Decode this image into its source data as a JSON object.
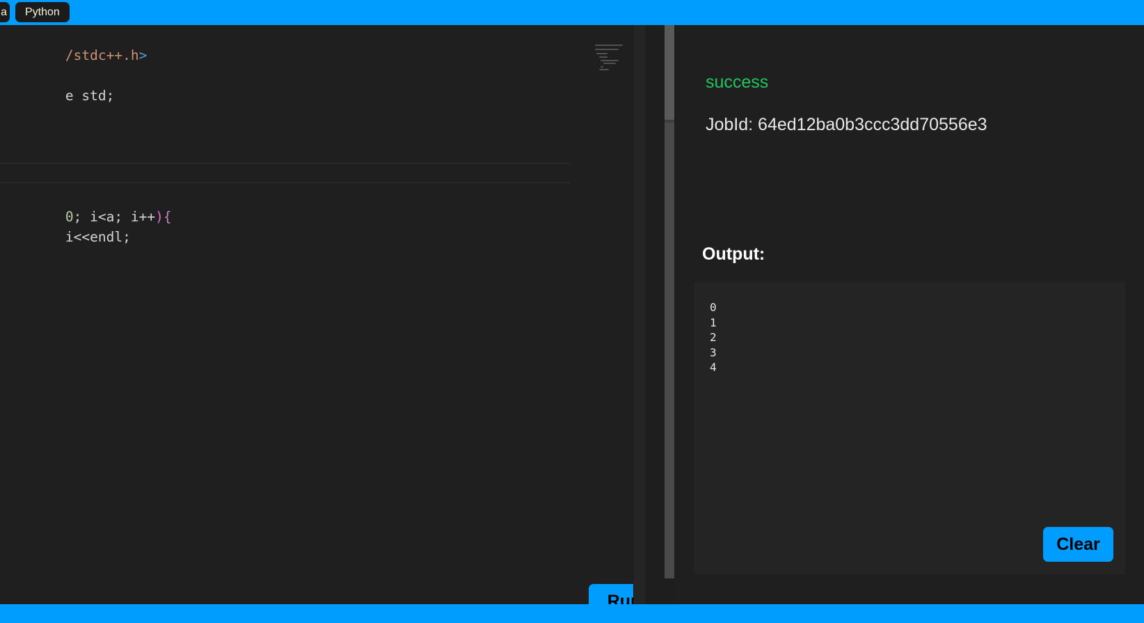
{
  "topbar": {
    "background_color": "#009dff",
    "language_tabs": [
      {
        "label": "a",
        "clipped": true
      },
      {
        "label": "Python",
        "clipped": false
      }
    ]
  },
  "editor": {
    "language": "cpp",
    "horizontally_scrolled": true,
    "visible_lines": [
      {
        "text": "/stdc++.h>",
        "tokens": [
          {
            "t": "/stdc++.h",
            "c": "inc"
          },
          {
            "t": ">",
            "c": "op"
          }
        ]
      },
      {
        "text": "",
        "tokens": []
      },
      {
        "text": "e std;",
        "tokens": [
          {
            "t": "e std;",
            "c": "plain"
          }
        ]
      },
      {
        "text": "",
        "tokens": []
      },
      {
        "text": "",
        "tokens": []
      },
      {
        "text": "",
        "tokens": []
      },
      {
        "text": "",
        "tokens": []
      },
      {
        "text": "",
        "tokens": []
      },
      {
        "text": "0; i<a; i++){",
        "tokens": [
          {
            "t": "0",
            "c": "num"
          },
          {
            "t": "; i<a; i++",
            "c": "plain"
          },
          {
            "t": ")",
            "c": "paren"
          },
          {
            "t": "{",
            "c": "key"
          }
        ]
      },
      {
        "text": "i<<endl;",
        "tokens": [
          {
            "t": "i<<endl;",
            "c": "plain"
          }
        ]
      }
    ],
    "run_button_label": "Run"
  },
  "result": {
    "status": "success",
    "status_color": "#22c55e",
    "job_id_label": "JobId: 64ed12ba0b3ccc3dd70556e3",
    "output_heading": "Output:",
    "output_text": "0\n1\n2\n3\n4",
    "clear_button_label": "Clear"
  },
  "bottombar": {
    "background_color": "#009dff"
  }
}
